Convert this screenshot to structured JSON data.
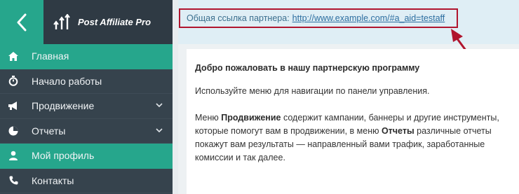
{
  "header": {
    "brand_name": "Post Affiliate Pro",
    "accent_color": "#26a68c",
    "sidebar_color": "#36434d"
  },
  "partner_link": {
    "label": "Общая ссылка партнера:",
    "url": "http://www.example.com/#a_aid=testaff",
    "highlight_color": "#b0152e"
  },
  "sidebar": {
    "items": [
      {
        "label": "Главная",
        "icon": "home-icon",
        "active": true,
        "has_chevron": false
      },
      {
        "label": "Начало работы",
        "icon": "stopwatch-icon",
        "active": false,
        "has_chevron": false
      },
      {
        "label": "Продвижение",
        "icon": "megaphone-icon",
        "active": false,
        "has_chevron": true
      },
      {
        "label": "Отчеты",
        "icon": "pie-chart-icon",
        "active": false,
        "has_chevron": true
      },
      {
        "label": "Мой профиль",
        "icon": "user-icon",
        "active": true,
        "has_chevron": false
      },
      {
        "label": "Контакты",
        "icon": "phone-icon",
        "active": false,
        "has_chevron": false
      }
    ]
  },
  "content": {
    "welcome_title": "Добро пожаловать в нашу партнерскую программу",
    "intro": "Используйте меню для навигации по панели управления.",
    "p2_part1": "Меню ",
    "p2_bold1": "Продвижение",
    "p2_part2": " содержит кампании, баннеры и другие инструменты, которые помогут вам в продвижении, в меню ",
    "p2_bold2": "Отчеты",
    "p2_part3": " различные отчеты покажут вам результаты — направленный вами трафик, заработанные комиссии и так далее."
  }
}
